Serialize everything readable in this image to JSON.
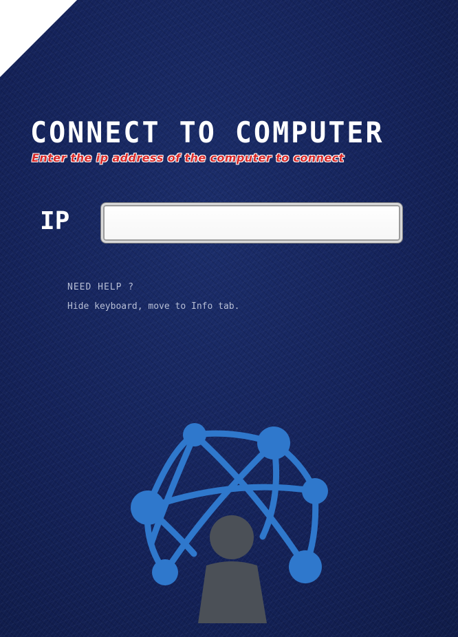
{
  "header": {
    "title": "CONNECT TO COMPUTER",
    "subtitle": "Enter the ip address of the computer to connect"
  },
  "form": {
    "ip_label": "IP",
    "ip_value": "",
    "ip_placeholder": ""
  },
  "help": {
    "title": "NEED HELP ?",
    "text": "Hide keyboard, move to Info tab."
  },
  "illustration": {
    "icon": "network-user-icon",
    "node_color": "#2f78cc",
    "person_color": "#4b5057"
  },
  "colors": {
    "background": "#142259",
    "subtitle": "#d72a2a",
    "title": "#ffffff"
  }
}
